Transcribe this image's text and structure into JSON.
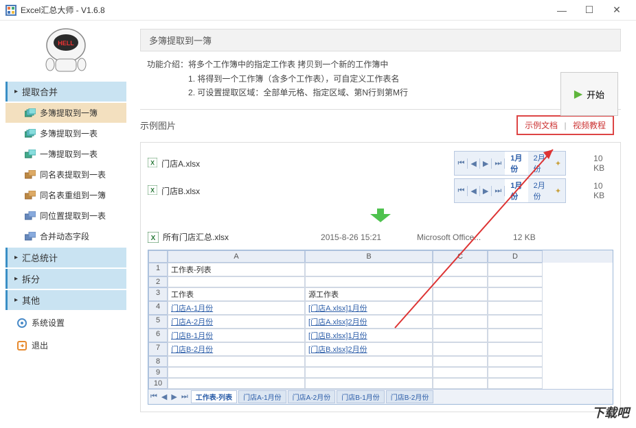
{
  "window": {
    "title": "Excel汇总大师 - V1.6.8"
  },
  "sidebar": {
    "categories": [
      {
        "label": "提取合并",
        "expanded": true
      },
      {
        "label": "汇总统计",
        "expanded": false
      },
      {
        "label": "拆分",
        "expanded": false
      },
      {
        "label": "其他",
        "expanded": false
      }
    ],
    "items": [
      "多簿提取到一簿",
      "多簿提取到一表",
      "一簿提取到一表",
      "同名表提取到一表",
      "同名表重组到一簿",
      "同位置提取到一表",
      "合并动态字段"
    ],
    "system_settings": "系统设置",
    "exit": "退出"
  },
  "content": {
    "section_title": "多簿提取到一簿",
    "intro_label": "功能介绍：",
    "intro_text": "将多个工作簿中的指定工作表 拷贝到一个新的工作簿中",
    "bullet1": "1. 将得到一个工作簿（含多个工作表），可自定义工作表名",
    "bullet2": "2. 可设置提取区域：全部单元格、指定区域、第N行到第M行",
    "start_label": "开始",
    "example_title": "示例图片",
    "link_doc": "示例文档",
    "link_video": "视频教程"
  },
  "files": {
    "src": [
      {
        "name": "门店A.xlsx",
        "tabs": [
          "1月份",
          "2月份"
        ],
        "size": "10 KB"
      },
      {
        "name": "门店B.xlsx",
        "tabs": [
          "1月份",
          "2月份"
        ],
        "size": "10 KB"
      }
    ],
    "result": {
      "name": "所有门店汇总.xlsx",
      "date": "2015-8-26 15:21",
      "type": "Microsoft Office...",
      "size": "12 KB"
    }
  },
  "sheet": {
    "cols": [
      "A",
      "B",
      "C",
      "D"
    ],
    "rows": [
      {
        "n": "1",
        "a": "工作表-列表",
        "b": ""
      },
      {
        "n": "2",
        "a": "",
        "b": ""
      },
      {
        "n": "3",
        "a": "工作表",
        "b": "源工作表"
      },
      {
        "n": "4",
        "a": "门店A-1月份",
        "b": "[门店A.xlsx]1月份",
        "link": true
      },
      {
        "n": "5",
        "a": "门店A-2月份",
        "b": "[门店A.xlsx]2月份",
        "link": true
      },
      {
        "n": "6",
        "a": "门店B-1月份",
        "b": "[门店B.xlsx]1月份",
        "link": true
      },
      {
        "n": "7",
        "a": "门店B-2月份",
        "b": "[门店B.xlsx]2月份",
        "link": true
      },
      {
        "n": "8",
        "a": "",
        "b": ""
      },
      {
        "n": "9",
        "a": "",
        "b": ""
      },
      {
        "n": "10",
        "a": "",
        "b": ""
      }
    ],
    "tabs": [
      "工作表-列表",
      "门店A-1月份",
      "门店A-2月份",
      "门店B-1月份",
      "门店B-2月份"
    ]
  },
  "watermark": "下载吧"
}
